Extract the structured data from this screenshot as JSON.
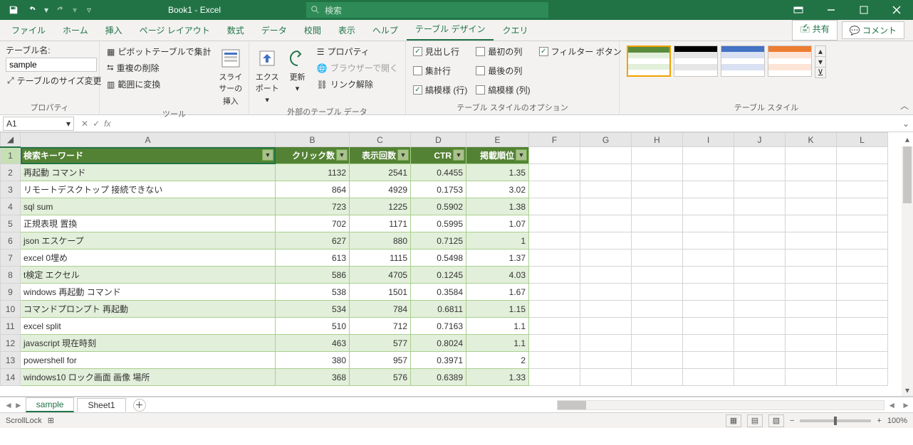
{
  "titlebar": {
    "title": "Book1  -  Excel",
    "search_placeholder": "検索"
  },
  "tabs": [
    "ファイル",
    "ホーム",
    "挿入",
    "ページ レイアウト",
    "数式",
    "データ",
    "校閲",
    "表示",
    "ヘルプ",
    "テーブル デザイン",
    "クエリ"
  ],
  "active_tab": "テーブル デザイン",
  "share_label": "共有",
  "comment_label": "コメント",
  "ribbon": {
    "properties": {
      "label": "プロパティ",
      "name_label": "テーブル名:",
      "table_name": "sample",
      "resize": "テーブルのサイズ変更"
    },
    "tools": {
      "label": "ツール",
      "pivot": "ピボットテーブルで集計",
      "dedup": "重複の削除",
      "torange": "範囲に変換",
      "slicer_top": "スライサーの",
      "slicer_bottom": "挿入"
    },
    "external": {
      "label": "外部のテーブル データ",
      "export": "エクスポート",
      "refresh": "更新",
      "props": "プロパティ",
      "browser": "ブラウザーで開く",
      "unlink": "リンク解除"
    },
    "options": {
      "label": "テーブル スタイルのオプション",
      "header": "見出し行",
      "total": "集計行",
      "bandrow": "縞模様 (行)",
      "firstcol": "最初の列",
      "lastcol": "最後の列",
      "bandcol": "縞模様 (列)",
      "filter": "フィルター ボタン"
    },
    "styles": {
      "label": "テーブル スタイル"
    }
  },
  "namebox": "A1",
  "columns": [
    "A",
    "B",
    "C",
    "D",
    "E",
    "F",
    "G",
    "H",
    "I",
    "J",
    "K",
    "L"
  ],
  "headers": [
    "検索キーワード",
    "クリック数",
    "表示回数",
    "CTR",
    "掲載順位"
  ],
  "rows": [
    [
      "再起動 コマンド",
      "1132",
      "2541",
      "0.4455",
      "1.35"
    ],
    [
      "リモートデスクトップ 接続できない",
      "864",
      "4929",
      "0.1753",
      "3.02"
    ],
    [
      "sql sum",
      "723",
      "1225",
      "0.5902",
      "1.38"
    ],
    [
      "正規表現 置換",
      "702",
      "1171",
      "0.5995",
      "1.07"
    ],
    [
      "json エスケープ",
      "627",
      "880",
      "0.7125",
      "1"
    ],
    [
      "excel 0埋め",
      "613",
      "1115",
      "0.5498",
      "1.37"
    ],
    [
      "t検定 エクセル",
      "586",
      "4705",
      "0.1245",
      "4.03"
    ],
    [
      "windows 再起動 コマンド",
      "538",
      "1501",
      "0.3584",
      "1.67"
    ],
    [
      "コマンドプロンプト 再起動",
      "534",
      "784",
      "0.6811",
      "1.15"
    ],
    [
      "excel split",
      "510",
      "712",
      "0.7163",
      "1.1"
    ],
    [
      "javascript 現在時刻",
      "463",
      "577",
      "0.8024",
      "1.1"
    ],
    [
      "powershell for",
      "380",
      "957",
      "0.3971",
      "2"
    ],
    [
      "windows10 ロック画面 画像 場所",
      "368",
      "576",
      "0.6389",
      "1.33"
    ]
  ],
  "sheets": {
    "active": "sample",
    "other": "Sheet1"
  },
  "status": {
    "scrolllock": "ScrollLock",
    "zoom": "100%"
  }
}
